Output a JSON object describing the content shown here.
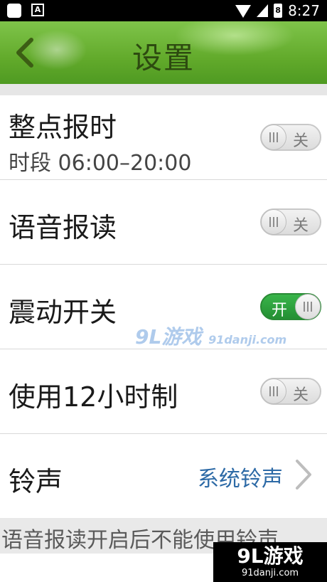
{
  "status_bar": {
    "time": "8:27",
    "app_icon": "A",
    "battery_icon_text": "8"
  },
  "header": {
    "title": "设置",
    "back_icon": "back-arrow-icon"
  },
  "settings": [
    {
      "label": "整点报时",
      "sub": "时段  06:00–20:00",
      "toggle": "关",
      "on": false
    },
    {
      "label": "语音报读",
      "toggle": "关",
      "on": false
    },
    {
      "label": "震动开关",
      "toggle": "开",
      "on": true
    },
    {
      "label": "使用12小时制",
      "toggle": "关",
      "on": false
    },
    {
      "label": "铃声",
      "value": "系统铃声"
    }
  ],
  "note": "语音报读开启后不能使用铃声",
  "watermark": {
    "center": "9L游戏",
    "center_sub": "91danji.com",
    "corner": "9L游戏",
    "corner_sub": "91danji.com"
  },
  "colors": {
    "header_green": "#62aa2b",
    "toggle_on": "#39b54a",
    "link_blue": "#2d6aa6"
  }
}
